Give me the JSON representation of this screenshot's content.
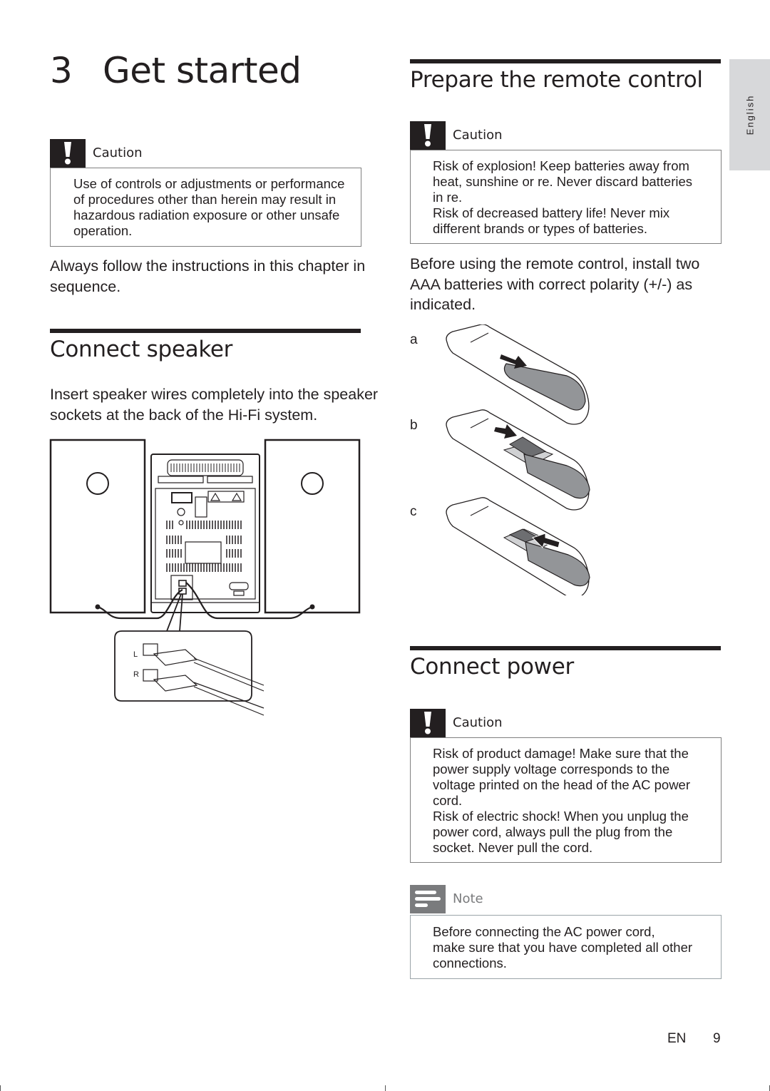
{
  "chapter": {
    "number": "3",
    "title": "Get started"
  },
  "language_tab": "English",
  "left_column": {
    "caution": {
      "label": "Caution",
      "icon": "exclamation-icon",
      "text": "Use of controls or adjustments or performance\nof procedures other than herein may result in\nhazardous radiation exposure or other unsafe\noperation."
    },
    "intro": "Always follow the instructions in this chapter in sequence.",
    "connect_speaker": {
      "title": "Connect speaker",
      "text": "Insert speaker wires completely into the speaker sockets at the back of the Hi-Fi system.",
      "figure": {
        "socket_labels": [
          "L",
          "R"
        ]
      }
    }
  },
  "right_column": {
    "remote": {
      "title": "Prepare the remote control",
      "caution": {
        "label": "Caution",
        "icon": "exclamation-icon",
        "text": "Risk of explosion! Keep batteries away from\nheat, sunshine or  re. Never discard batteries\nin  re.\nRisk of decreased battery life! Never mix\ndifferent brands or types of batteries."
      },
      "text": "Before using the remote control, install two AAA batteries with correct polarity (+/-) as indicated.",
      "steps": [
        "a",
        "b",
        "c"
      ]
    },
    "connect_power": {
      "title": "Connect power",
      "caution": {
        "label": "Caution",
        "icon": "exclamation-icon",
        "text": "Risk of product damage! Make sure that the\npower supply voltage corresponds to the\nvoltage printed on the head of the AC power\ncord.\nRisk of electric shock! When you unplug the\npower cord, always pull the plug from the\nsocket. Never pull the cord."
      },
      "note": {
        "label": "Note",
        "icon": "note-lines-icon",
        "text": "Before connecting the AC power cord,\nmake sure that you have completed all other\nconnections."
      }
    }
  },
  "footer": {
    "lang": "EN",
    "page": "9"
  },
  "colors": {
    "text": "#231f20",
    "tab_bg": "#d7d8da",
    "note_icon": "#7a7b7d"
  }
}
